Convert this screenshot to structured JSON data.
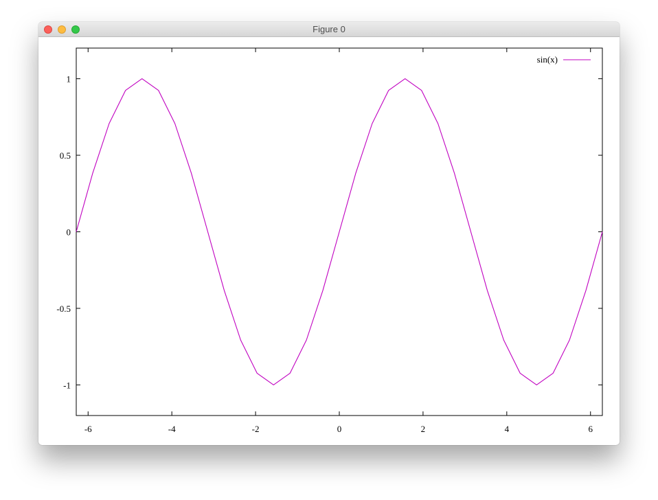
{
  "window": {
    "title": "Figure 0"
  },
  "colors": {
    "series": "#c000c0",
    "axes": "#000000"
  },
  "chart_data": {
    "type": "line",
    "title": "",
    "xlabel": "",
    "ylabel": "",
    "xlim": [
      -6.2832,
      6.2832
    ],
    "ylim": [
      -1.2,
      1.2
    ],
    "grid": false,
    "legend_position": "top-right",
    "xticks": [
      -6,
      -4,
      -2,
      0,
      2,
      4,
      6
    ],
    "yticks": [
      -1,
      -0.5,
      0,
      0.5,
      1
    ],
    "series": [
      {
        "name": "sin(x)",
        "color": "#c000c0",
        "x": [
          -6.2832,
          -5.8905,
          -5.4978,
          -5.1051,
          -4.7124,
          -4.3197,
          -3.927,
          -3.5343,
          -3.1416,
          -2.7489,
          -2.3562,
          -1.9635,
          -1.5708,
          -1.1781,
          -0.7854,
          -0.3927,
          0,
          0.3927,
          0.7854,
          1.1781,
          1.5708,
          1.9635,
          2.3562,
          2.7489,
          3.1416,
          3.5343,
          3.927,
          4.3197,
          4.7124,
          5.1051,
          5.4978,
          5.8905,
          6.2832
        ],
        "y": [
          0,
          0.3827,
          0.7071,
          0.9239,
          1,
          0.9239,
          0.7071,
          0.3827,
          0,
          -0.3827,
          -0.7071,
          -0.9239,
          -1,
          -0.9239,
          -0.7071,
          -0.3827,
          0,
          0.3827,
          0.7071,
          0.9239,
          1,
          0.9239,
          0.7071,
          0.3827,
          0,
          -0.3827,
          -0.7071,
          -0.9239,
          -1,
          -0.9239,
          -0.7071,
          -0.3827,
          0
        ]
      }
    ]
  }
}
